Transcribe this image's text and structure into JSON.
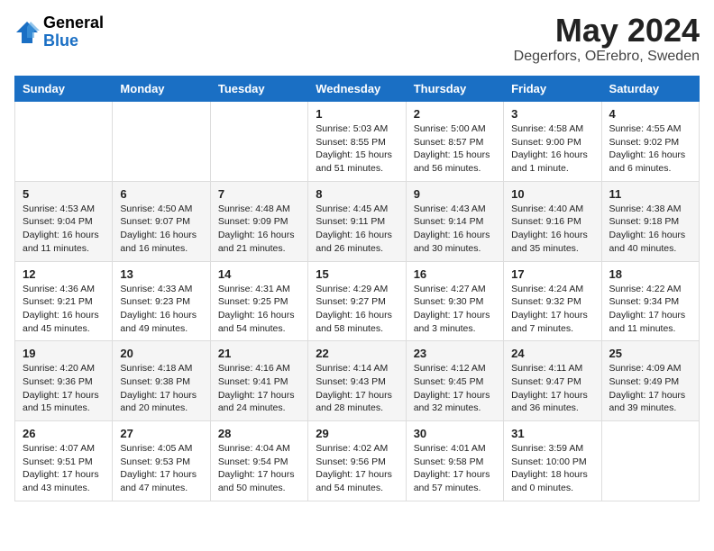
{
  "header": {
    "logo_general": "General",
    "logo_blue": "Blue",
    "month_title": "May 2024",
    "location": "Degerfors, OErebro, Sweden"
  },
  "days_of_week": [
    "Sunday",
    "Monday",
    "Tuesday",
    "Wednesday",
    "Thursday",
    "Friday",
    "Saturday"
  ],
  "weeks": [
    [
      {
        "day": "",
        "info": ""
      },
      {
        "day": "",
        "info": ""
      },
      {
        "day": "",
        "info": ""
      },
      {
        "day": "1",
        "info": "Sunrise: 5:03 AM\nSunset: 8:55 PM\nDaylight: 15 hours\nand 51 minutes."
      },
      {
        "day": "2",
        "info": "Sunrise: 5:00 AM\nSunset: 8:57 PM\nDaylight: 15 hours\nand 56 minutes."
      },
      {
        "day": "3",
        "info": "Sunrise: 4:58 AM\nSunset: 9:00 PM\nDaylight: 16 hours\nand 1 minute."
      },
      {
        "day": "4",
        "info": "Sunrise: 4:55 AM\nSunset: 9:02 PM\nDaylight: 16 hours\nand 6 minutes."
      }
    ],
    [
      {
        "day": "5",
        "info": "Sunrise: 4:53 AM\nSunset: 9:04 PM\nDaylight: 16 hours\nand 11 minutes."
      },
      {
        "day": "6",
        "info": "Sunrise: 4:50 AM\nSunset: 9:07 PM\nDaylight: 16 hours\nand 16 minutes."
      },
      {
        "day": "7",
        "info": "Sunrise: 4:48 AM\nSunset: 9:09 PM\nDaylight: 16 hours\nand 21 minutes."
      },
      {
        "day": "8",
        "info": "Sunrise: 4:45 AM\nSunset: 9:11 PM\nDaylight: 16 hours\nand 26 minutes."
      },
      {
        "day": "9",
        "info": "Sunrise: 4:43 AM\nSunset: 9:14 PM\nDaylight: 16 hours\nand 30 minutes."
      },
      {
        "day": "10",
        "info": "Sunrise: 4:40 AM\nSunset: 9:16 PM\nDaylight: 16 hours\nand 35 minutes."
      },
      {
        "day": "11",
        "info": "Sunrise: 4:38 AM\nSunset: 9:18 PM\nDaylight: 16 hours\nand 40 minutes."
      }
    ],
    [
      {
        "day": "12",
        "info": "Sunrise: 4:36 AM\nSunset: 9:21 PM\nDaylight: 16 hours\nand 45 minutes."
      },
      {
        "day": "13",
        "info": "Sunrise: 4:33 AM\nSunset: 9:23 PM\nDaylight: 16 hours\nand 49 minutes."
      },
      {
        "day": "14",
        "info": "Sunrise: 4:31 AM\nSunset: 9:25 PM\nDaylight: 16 hours\nand 54 minutes."
      },
      {
        "day": "15",
        "info": "Sunrise: 4:29 AM\nSunset: 9:27 PM\nDaylight: 16 hours\nand 58 minutes."
      },
      {
        "day": "16",
        "info": "Sunrise: 4:27 AM\nSunset: 9:30 PM\nDaylight: 17 hours\nand 3 minutes."
      },
      {
        "day": "17",
        "info": "Sunrise: 4:24 AM\nSunset: 9:32 PM\nDaylight: 17 hours\nand 7 minutes."
      },
      {
        "day": "18",
        "info": "Sunrise: 4:22 AM\nSunset: 9:34 PM\nDaylight: 17 hours\nand 11 minutes."
      }
    ],
    [
      {
        "day": "19",
        "info": "Sunrise: 4:20 AM\nSunset: 9:36 PM\nDaylight: 17 hours\nand 15 minutes."
      },
      {
        "day": "20",
        "info": "Sunrise: 4:18 AM\nSunset: 9:38 PM\nDaylight: 17 hours\nand 20 minutes."
      },
      {
        "day": "21",
        "info": "Sunrise: 4:16 AM\nSunset: 9:41 PM\nDaylight: 17 hours\nand 24 minutes."
      },
      {
        "day": "22",
        "info": "Sunrise: 4:14 AM\nSunset: 9:43 PM\nDaylight: 17 hours\nand 28 minutes."
      },
      {
        "day": "23",
        "info": "Sunrise: 4:12 AM\nSunset: 9:45 PM\nDaylight: 17 hours\nand 32 minutes."
      },
      {
        "day": "24",
        "info": "Sunrise: 4:11 AM\nSunset: 9:47 PM\nDaylight: 17 hours\nand 36 minutes."
      },
      {
        "day": "25",
        "info": "Sunrise: 4:09 AM\nSunset: 9:49 PM\nDaylight: 17 hours\nand 39 minutes."
      }
    ],
    [
      {
        "day": "26",
        "info": "Sunrise: 4:07 AM\nSunset: 9:51 PM\nDaylight: 17 hours\nand 43 minutes."
      },
      {
        "day": "27",
        "info": "Sunrise: 4:05 AM\nSunset: 9:53 PM\nDaylight: 17 hours\nand 47 minutes."
      },
      {
        "day": "28",
        "info": "Sunrise: 4:04 AM\nSunset: 9:54 PM\nDaylight: 17 hours\nand 50 minutes."
      },
      {
        "day": "29",
        "info": "Sunrise: 4:02 AM\nSunset: 9:56 PM\nDaylight: 17 hours\nand 54 minutes."
      },
      {
        "day": "30",
        "info": "Sunrise: 4:01 AM\nSunset: 9:58 PM\nDaylight: 17 hours\nand 57 minutes."
      },
      {
        "day": "31",
        "info": "Sunrise: 3:59 AM\nSunset: 10:00 PM\nDaylight: 18 hours\nand 0 minutes."
      },
      {
        "day": "",
        "info": ""
      }
    ]
  ]
}
